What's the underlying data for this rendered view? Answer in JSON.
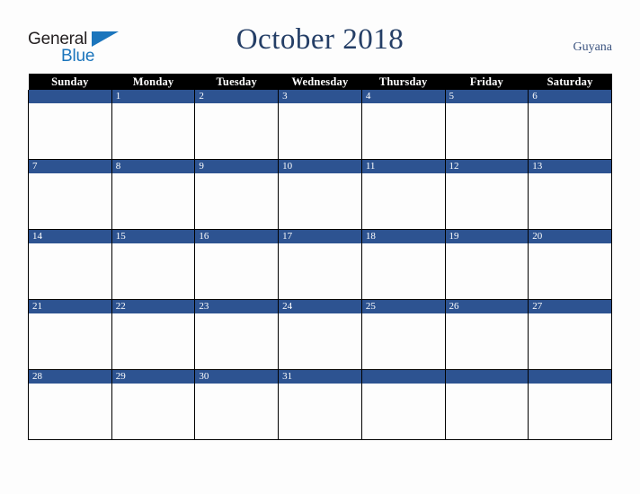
{
  "brand": {
    "name_part1": "General",
    "name_part2": "Blue",
    "triangle_icon": "blue-triangle-icon",
    "colors": {
      "dark": "#231f20",
      "blue": "#1b75bc"
    }
  },
  "header": {
    "title": "October 2018",
    "region": "Guyana",
    "title_color": "#243e66",
    "region_color": "#3c5480"
  },
  "calendar": {
    "month": "October",
    "year": "2018",
    "weekday_headers": [
      "Sunday",
      "Monday",
      "Tuesday",
      "Wednesday",
      "Thursday",
      "Friday",
      "Saturday"
    ],
    "header_background": "#000000",
    "header_text_color": "#ffffff",
    "daynum_background": "#2d5391",
    "daynum_text_color": "#ffffff",
    "cell_background": "#fdfdfd",
    "grid_line_color": "#000000",
    "weeks": [
      {
        "days": [
          "",
          "1",
          "2",
          "3",
          "4",
          "5",
          "6"
        ]
      },
      {
        "days": [
          "7",
          "8",
          "9",
          "10",
          "11",
          "12",
          "13"
        ]
      },
      {
        "days": [
          "14",
          "15",
          "16",
          "17",
          "18",
          "19",
          "20"
        ]
      },
      {
        "days": [
          "21",
          "22",
          "23",
          "24",
          "25",
          "26",
          "27"
        ]
      },
      {
        "days": [
          "28",
          "29",
          "30",
          "31",
          "",
          "",
          ""
        ]
      }
    ]
  }
}
